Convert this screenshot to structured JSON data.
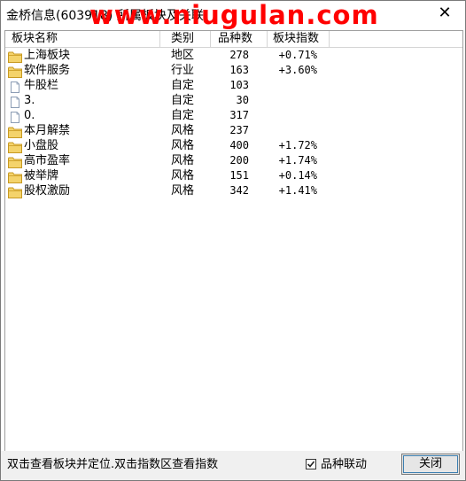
{
  "window": {
    "title": "金桥信息(603918) 所属板块及关联",
    "watermark": "www.niugulan.com",
    "close_glyph": "✕"
  },
  "table": {
    "columns": [
      "板块名称",
      "类别",
      "品种数",
      "板块指数"
    ],
    "rows": [
      {
        "icon": "folder-icon",
        "name": "上海板块",
        "type": "地区",
        "count": "278",
        "index": "+0.71%"
      },
      {
        "icon": "folder-icon",
        "name": "软件服务",
        "type": "行业",
        "count": "163",
        "index": "+3.60%"
      },
      {
        "icon": "document-icon",
        "name": "牛股栏",
        "type": "自定",
        "count": "103",
        "index": ""
      },
      {
        "icon": "document-icon",
        "name": "3.",
        "type": "自定",
        "count": "30",
        "index": ""
      },
      {
        "icon": "document-icon",
        "name": "0.",
        "type": "自定",
        "count": "317",
        "index": ""
      },
      {
        "icon": "folder-icon",
        "name": "本月解禁",
        "type": "风格",
        "count": "237",
        "index": ""
      },
      {
        "icon": "folder-icon",
        "name": "小盘股",
        "type": "风格",
        "count": "400",
        "index": "+1.72%"
      },
      {
        "icon": "folder-icon",
        "name": "高市盈率",
        "type": "风格",
        "count": "200",
        "index": "+1.74%"
      },
      {
        "icon": "folder-icon",
        "name": "被举牌",
        "type": "风格",
        "count": "151",
        "index": "+0.14%"
      },
      {
        "icon": "folder-icon",
        "name": "股权激励",
        "type": "风格",
        "count": "342",
        "index": "+1.41%"
      }
    ]
  },
  "status": {
    "hint": "双击查看板块并定位.双击指数区查看指数",
    "linkage_label": "品种联动",
    "linkage_checked": true,
    "close_button": "关闭"
  },
  "colors": {
    "watermark": "#ff0000",
    "folder_fill": "#f4d36b",
    "folder_edge": "#c89a22",
    "doc_edge": "#8c9db5"
  }
}
